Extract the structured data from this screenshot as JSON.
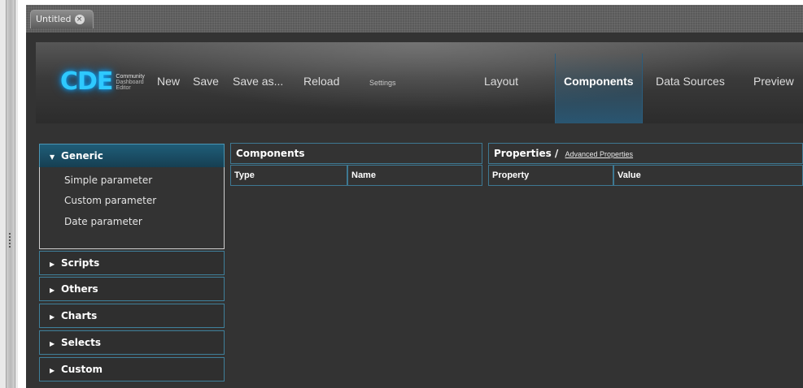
{
  "document_tab": {
    "title": "Untitled",
    "close_glyph": "×"
  },
  "logo": {
    "mark": "CDE",
    "line1": "Community",
    "line2": "Dashboard",
    "line3": "Editor"
  },
  "toolbar": {
    "new_label": "New",
    "save_label": "Save",
    "save_as_label": "Save as...",
    "reload_label": "Reload",
    "settings_label": "Settings"
  },
  "views": {
    "layout": "Layout",
    "components": "Components",
    "data_sources": "Data Sources",
    "preview": "Preview",
    "active": "Components"
  },
  "sidebar": {
    "groups": [
      {
        "label": "Generic",
        "expanded": true,
        "items": [
          "Simple parameter",
          "Custom parameter",
          "Date parameter"
        ]
      },
      {
        "label": "Scripts",
        "expanded": false
      },
      {
        "label": "Others",
        "expanded": false
      },
      {
        "label": "Charts",
        "expanded": false
      },
      {
        "label": "Selects",
        "expanded": false
      },
      {
        "label": "Custom",
        "expanded": false
      }
    ]
  },
  "components_panel": {
    "title": "Components",
    "columns": [
      "Type",
      "Name"
    ]
  },
  "properties_panel": {
    "title": "Properties",
    "separator": "/",
    "advanced_link": "Advanced Properties",
    "columns": [
      "Property",
      "Value"
    ]
  },
  "colors": {
    "accent": "#3e7892",
    "logo": "#2ec9ff",
    "background": "#333333"
  }
}
